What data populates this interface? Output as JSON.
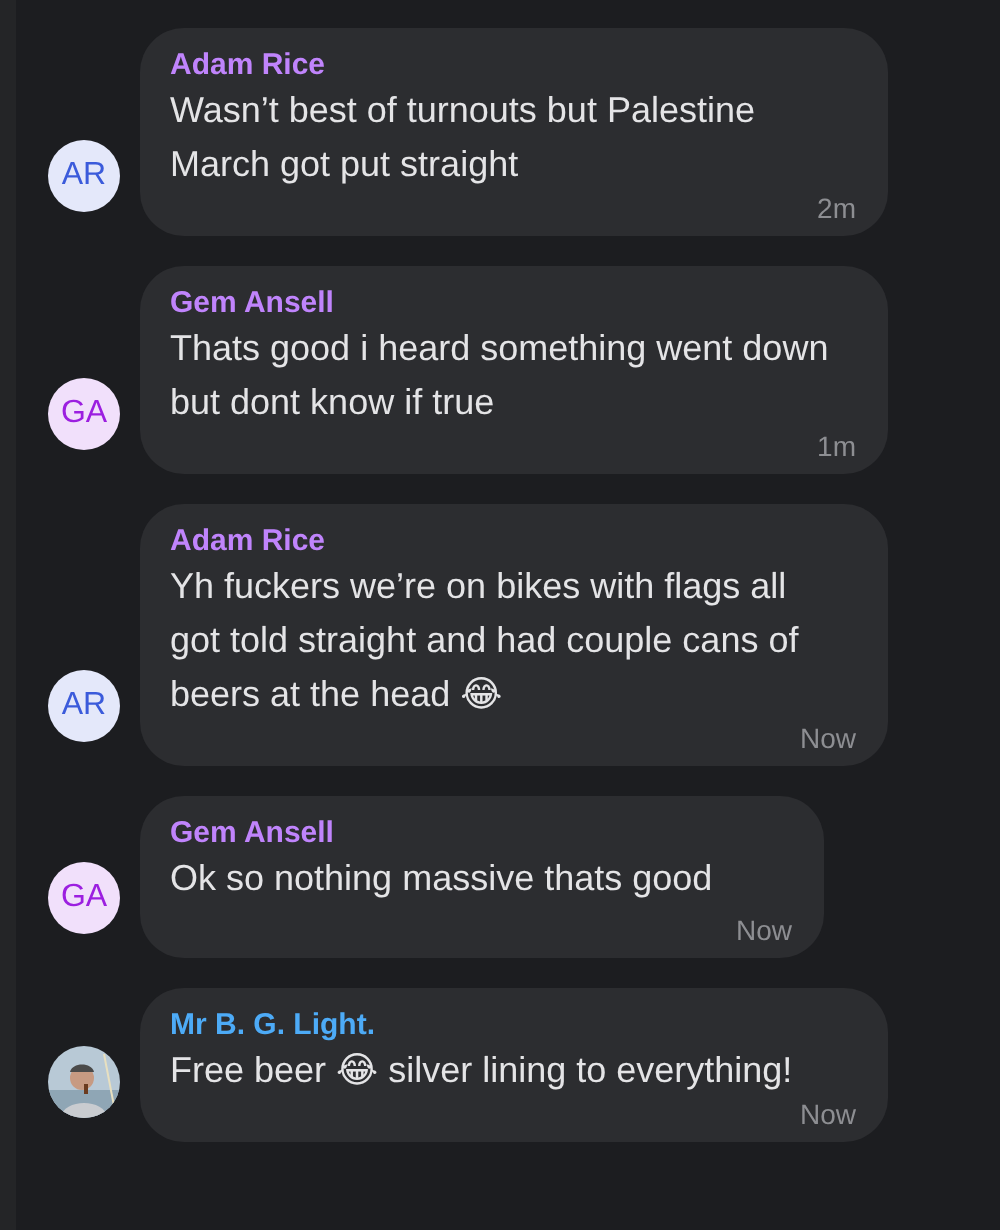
{
  "messages": [
    {
      "sender": "Adam Rice",
      "color": "#c084fc",
      "avatar": {
        "kind": "initials",
        "text": "AR",
        "color": "#3b5bdb"
      },
      "text": "Wasn’t best of turnouts but Palestine March got put straight",
      "time": "2m"
    },
    {
      "sender": "Gem Ansell",
      "color": "#c084fc",
      "avatar": {
        "kind": "initials",
        "text": "GA",
        "color": "#9c1fe0"
      },
      "text": "Thats good i heard something went down but dont know if true",
      "time": "1m"
    },
    {
      "sender": "Adam Rice",
      "color": "#c084fc",
      "avatar": {
        "kind": "initials",
        "text": "AR",
        "color": "#3b5bdb"
      },
      "text": "Yh fuckers we’re on bikes with flags all got told straight and had couple cans of beers at the head 😂",
      "time": "Now"
    },
    {
      "sender": "Gem Ansell",
      "color": "#c084fc",
      "avatar": {
        "kind": "initials",
        "text": "GA",
        "color": "#9c1fe0"
      },
      "text": "Ok so nothing massive thats good",
      "time": "Now"
    },
    {
      "sender": "Mr B. G. Light.",
      "color": "#4dabf7",
      "text": "Free beer 😂 silver lining to everything!",
      "time": "Now"
    }
  ]
}
